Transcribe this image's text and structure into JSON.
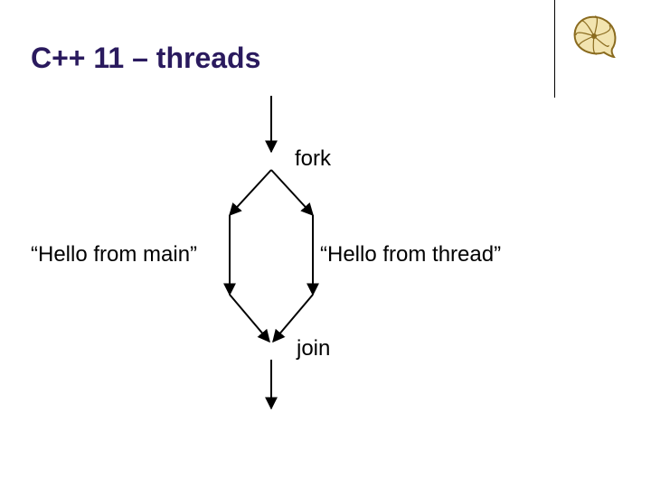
{
  "title": "C++ 11 – threads",
  "labels": {
    "fork": "fork",
    "join": "join",
    "main_msg": "“Hello from main”",
    "thread_msg": "“Hello from thread”"
  },
  "diagram": {
    "type": "fork-join",
    "description": "Single thread forks into two branches (main and thread), each prints a message, then both join back into one thread.",
    "nodes": [
      {
        "id": "start",
        "kind": "single-thread"
      },
      {
        "id": "fork",
        "kind": "fork",
        "label_key": "labels.fork"
      },
      {
        "id": "left-branch",
        "kind": "thread",
        "output_key": "labels.main_msg"
      },
      {
        "id": "right-branch",
        "kind": "thread",
        "output_key": "labels.thread_msg"
      },
      {
        "id": "join",
        "kind": "join",
        "label_key": "labels.join"
      },
      {
        "id": "end",
        "kind": "single-thread"
      }
    ],
    "edges": [
      [
        "start",
        "fork"
      ],
      [
        "fork",
        "left-branch"
      ],
      [
        "fork",
        "right-branch"
      ],
      [
        "left-branch",
        "join"
      ],
      [
        "right-branch",
        "join"
      ],
      [
        "join",
        "end"
      ]
    ]
  },
  "colors": {
    "title": "#2a1a5e",
    "lines": "#000000",
    "shell_outer": "#d4b45a",
    "shell_inner": "#f2e4b0"
  }
}
